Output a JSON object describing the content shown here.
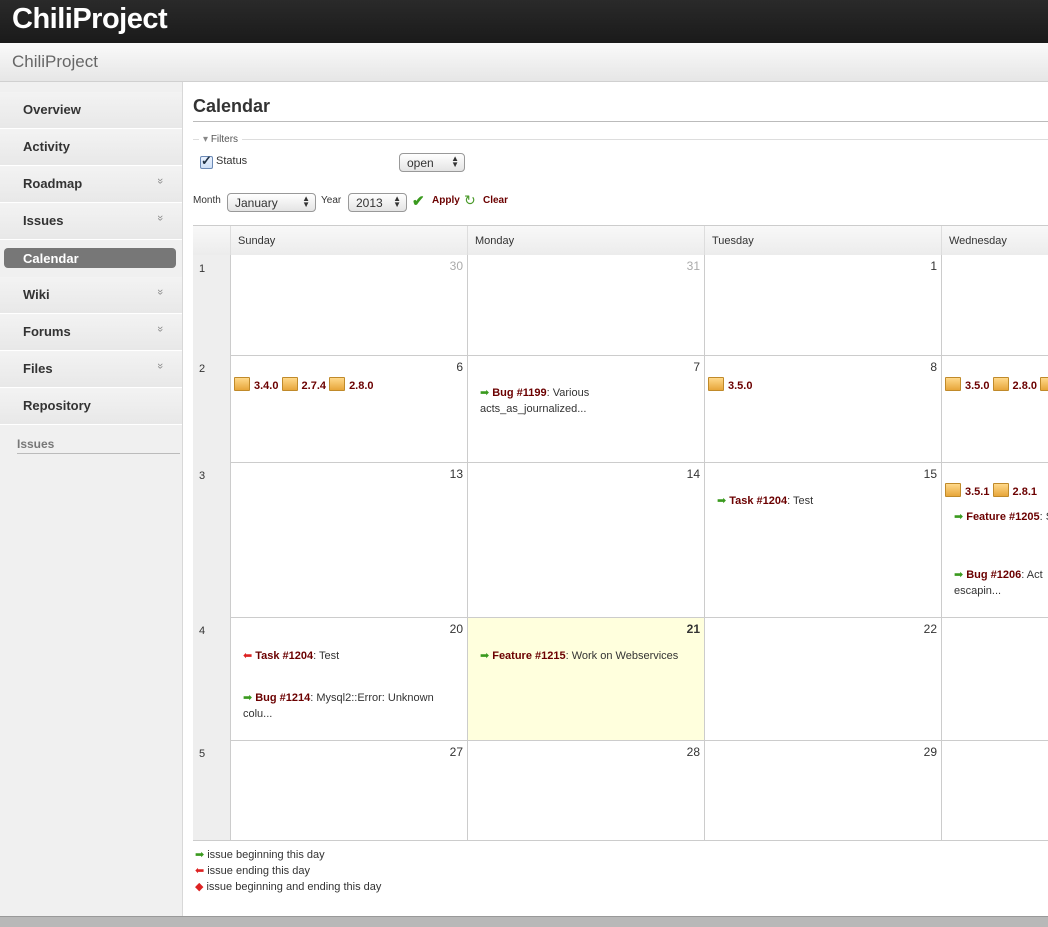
{
  "app": {
    "brand": "ChiliProject",
    "project": "ChiliProject"
  },
  "sidebar": {
    "items": [
      {
        "label": "Overview",
        "chevron": false
      },
      {
        "label": "Activity",
        "chevron": false
      },
      {
        "label": "Roadmap",
        "chevron": true
      },
      {
        "label": "Issues",
        "chevron": true
      },
      {
        "label": "Calendar",
        "chevron": false,
        "selected": true
      },
      {
        "label": "Wiki",
        "chevron": true
      },
      {
        "label": "Forums",
        "chevron": true
      },
      {
        "label": "Files",
        "chevron": true
      },
      {
        "label": "Repository",
        "chevron": false
      }
    ],
    "section": "Issues",
    "chevron_glyph": "»"
  },
  "page": {
    "title": "Calendar"
  },
  "filters": {
    "legend": "Filters",
    "legend_icon": "▾",
    "status_label": "Status",
    "status_checked": true,
    "status_value": "open",
    "month_label": "Month",
    "month_value": "January",
    "year_label": "Year",
    "year_value": "2013",
    "apply": "Apply",
    "clear": "Clear"
  },
  "calendar": {
    "days": [
      "Sunday",
      "Monday",
      "Tuesday",
      "Wednesday"
    ],
    "weeks": [
      "1",
      "2",
      "3",
      "4",
      "5"
    ],
    "cells": [
      [
        "30",
        "31",
        "1",
        ""
      ],
      [
        "6",
        "7",
        "8",
        ""
      ],
      [
        "13",
        "14",
        "15",
        ""
      ],
      [
        "20",
        "21",
        "22",
        ""
      ],
      [
        "27",
        "28",
        "29",
        ""
      ]
    ],
    "versions": {
      "w2_sun": [
        "3.4.0",
        "2.7.4",
        "2.8.0"
      ],
      "w2_tue": [
        "3.5.0"
      ],
      "w2_wed": [
        "3.5.0",
        "2.8.0"
      ],
      "w3_wed": [
        "3.5.1",
        "2.8.1"
      ]
    },
    "issues": {
      "bug1199": {
        "label": "Bug #1199",
        "text": ": Various acts_as_journalized..."
      },
      "task1204_start": {
        "label": "Task #1204",
        "text": ": Test"
      },
      "feature1205": {
        "label": "Feature #1205",
        "text": ": Sites"
      },
      "bug1206": {
        "label": "Bug #1206",
        "text": ": Act escapin..."
      },
      "task1204_end": {
        "label": "Task #1204",
        "text": ": Test"
      },
      "bug1214": {
        "label": "Bug #1214",
        "text": ": Mysql2::Error: Unknown colu..."
      },
      "feature1215": {
        "label": "Feature #1215",
        "text": ": Work on Webservices"
      }
    }
  },
  "legend": {
    "begin": "issue beginning this day",
    "end": "issue ending this day",
    "both": "issue beginning and ending this day"
  },
  "colors": {
    "link": "#6b0000",
    "today": "#ffffdd",
    "arrow_green": "#3a9a1e",
    "arrow_red": "#dd2222"
  }
}
